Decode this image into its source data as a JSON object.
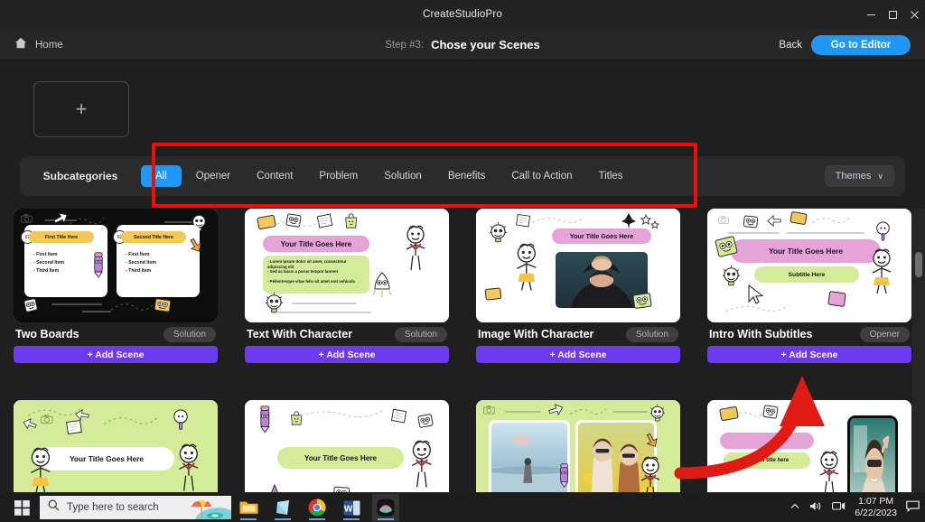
{
  "window": {
    "title": "CreateStudioPro",
    "controls": [
      {
        "name": "minimize-button",
        "glyph": "minimize"
      },
      {
        "name": "maximize-button",
        "glyph": "maximize"
      },
      {
        "name": "close-button",
        "glyph": "close"
      }
    ]
  },
  "header": {
    "home_label": "Home",
    "home_icon": "home-icon",
    "step_number": "Step #3:",
    "step_title": "Chose your Scenes",
    "back_label": "Back",
    "editor_label": "Go to Editor",
    "accent_blue": "#2196f3"
  },
  "add_card": {
    "plus": "+"
  },
  "subcategories": {
    "label": "Subcategories",
    "tabs": [
      {
        "label": "All",
        "active": true
      },
      {
        "label": "Opener",
        "active": false
      },
      {
        "label": "Content",
        "active": false
      },
      {
        "label": "Problem",
        "active": false
      },
      {
        "label": "Solution",
        "active": false
      },
      {
        "label": "Benefits",
        "active": false
      },
      {
        "label": "Call to Action",
        "active": false
      },
      {
        "label": "Titles",
        "active": false
      }
    ],
    "themes_label": "Themes",
    "themes_caret": "∨"
  },
  "cards": [
    {
      "name": "Two Boards",
      "badge": "Solution",
      "add_label": "+ Add Scene",
      "thumb": {
        "style": "two-boards",
        "bg": "#0d0d0d",
        "title_left": "First Title Here",
        "title_right": "Second Title Here",
        "num_left": "01",
        "num_right": "02",
        "bullets": [
          "- First Item",
          "- Second Item",
          "- Third Item"
        ]
      }
    },
    {
      "name": "Text With Character",
      "badge": "Solution",
      "add_label": "+ Add Scene",
      "thumb": {
        "style": "text-with-character",
        "bg": "#ffffff",
        "title": "Your Title Goes Here",
        "body_lines": [
          "- Lorem ipsum dolor sit amet, consectetur adipiscing elit",
          "- Sed ac lacus a purus tempor laoreet",
          "- Pellentesque vitae felis sit amet erat vehicula"
        ]
      }
    },
    {
      "name": "Image With Character",
      "badge": "Solution",
      "add_label": "+ Add Scene",
      "thumb": {
        "style": "image-with-character",
        "bg": "#ffffff",
        "title": "Your Title Goes Here"
      }
    },
    {
      "name": "Intro With Subtitles",
      "badge": "Opener",
      "add_label": "+ Add Scene",
      "thumb": {
        "style": "intro-with-subtitles",
        "bg": "#ffffff",
        "title": "Your Title Goes Here",
        "subtitle": "Subtitle Here"
      }
    },
    {
      "name": "",
      "badge": "",
      "add_label": "",
      "thumb": {
        "style": "green-title",
        "bg": "#d4ec9a",
        "title": "Your Title Goes Here"
      }
    },
    {
      "name": "",
      "badge": "",
      "add_label": "",
      "thumb": {
        "style": "white-green-title",
        "bg": "#ffffff",
        "title": "Your Title Goes Here"
      }
    },
    {
      "name": "",
      "badge": "",
      "add_label": "",
      "thumb": {
        "style": "two-photos-green",
        "bg": "#d4ec9a",
        "title": ""
      }
    },
    {
      "name": "",
      "badge": "",
      "add_label": "",
      "thumb": {
        "style": "phone-subtitle",
        "bg": "#ffffff",
        "title": "",
        "subtitle": "Second title here"
      }
    }
  ],
  "annotations": {
    "box_color": "#f10b0b",
    "arrow_color": "#e01b13"
  },
  "scrollbar": {
    "name": "vertical-scrollbar"
  },
  "taskbar": {
    "search_placeholder": "Type here to search",
    "search_icon": "search-icon",
    "start_icon": "windows-start-icon",
    "apps": [
      {
        "name": "file-explorer-icon"
      },
      {
        "name": "microsoft-store-icon"
      },
      {
        "name": "google-chrome-icon"
      },
      {
        "name": "microsoft-word-icon"
      },
      {
        "name": "createstudio-icon",
        "active": true
      }
    ],
    "tray": {
      "chevron": "show-hidden-icons",
      "volume": "volume-icon",
      "network": "network-icon",
      "time": "1:07 PM",
      "date": "6/22/2023",
      "notifications": "notifications-icon"
    }
  }
}
